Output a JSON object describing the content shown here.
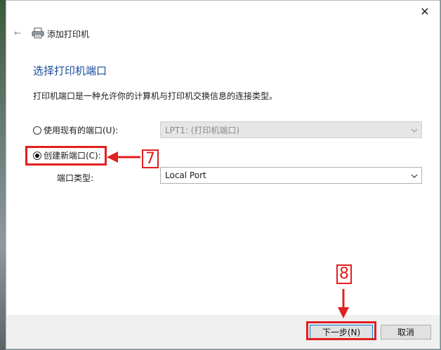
{
  "window": {
    "title": "添加打印机",
    "close_glyph": "✕",
    "back_glyph": "←"
  },
  "content": {
    "heading": "选择打印机端口",
    "description": "打印机端口是一种允许你的计算机与打印机交换信息的连接类型。"
  },
  "options": {
    "existing_label": "使用现有的端口(U):",
    "existing_value": "LPT1: (打印机端口)",
    "new_label": "创建新端口(C):",
    "port_type_label": "端口类型:",
    "port_type_value": "Local Port",
    "selected": "new"
  },
  "buttons": {
    "next": "下一步(N)",
    "cancel": "取消"
  },
  "annotations": {
    "step7": "7",
    "step8": "8"
  },
  "colors": {
    "heading": "#1a4c9a",
    "highlight": "#e02020",
    "focus": "#0078d7"
  }
}
